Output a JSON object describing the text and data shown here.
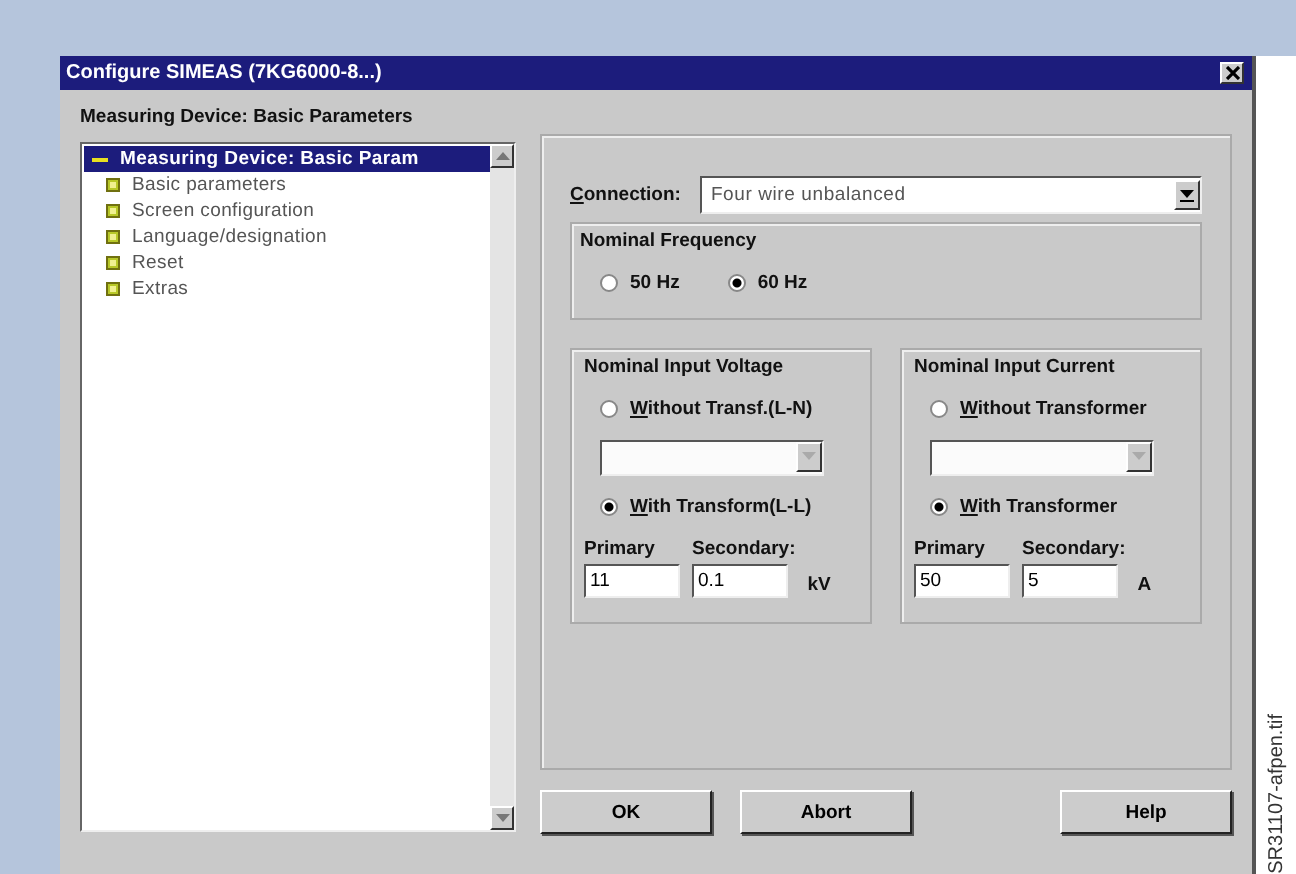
{
  "window": {
    "title": "Configure SIMEAS (7KG6000-8...)"
  },
  "heading": "Measuring Device: Basic Parameters",
  "tree": {
    "items": [
      {
        "label": "Measuring Device: Basic Param",
        "selected": true,
        "expanded": true,
        "children": [
          {
            "label": "Basic parameters",
            "selected": false
          },
          {
            "label": "Screen configuration",
            "selected": false
          },
          {
            "label": "Language/designation",
            "selected": false
          },
          {
            "label": "Reset",
            "selected": false
          },
          {
            "label": "Extras",
            "selected": false
          }
        ]
      }
    ]
  },
  "connection": {
    "label": "Connection:",
    "value": "Four wire unbalanced"
  },
  "frequency": {
    "title": "Nominal Frequency",
    "options": [
      {
        "label": "50 Hz",
        "selected": false
      },
      {
        "label": "60 Hz",
        "selected": true
      }
    ]
  },
  "inputs": [
    {
      "title": "Nominal Input Voltage",
      "options": [
        {
          "label": "Without Transf.(L-N)",
          "selected": false
        },
        {
          "label": "With Transform(L-L)",
          "selected": true
        }
      ],
      "dropdown_disabled": true,
      "primary_label": "Primary",
      "secondary_label": "Secondary:",
      "primary": "11",
      "secondary": "0.1",
      "unit": "kV"
    },
    {
      "title": "Nominal Input Current",
      "options": [
        {
          "label": "Without Transformer",
          "selected": false
        },
        {
          "label": "With Transformer",
          "selected": true
        }
      ],
      "dropdown_disabled": true,
      "primary_label": "Primary",
      "secondary_label": "Secondary:",
      "primary": "50",
      "secondary": "5",
      "unit": "A"
    }
  ],
  "buttons": [
    "OK",
    "Abort",
    "Help"
  ],
  "caption": "SR31107-afpen.tif"
}
